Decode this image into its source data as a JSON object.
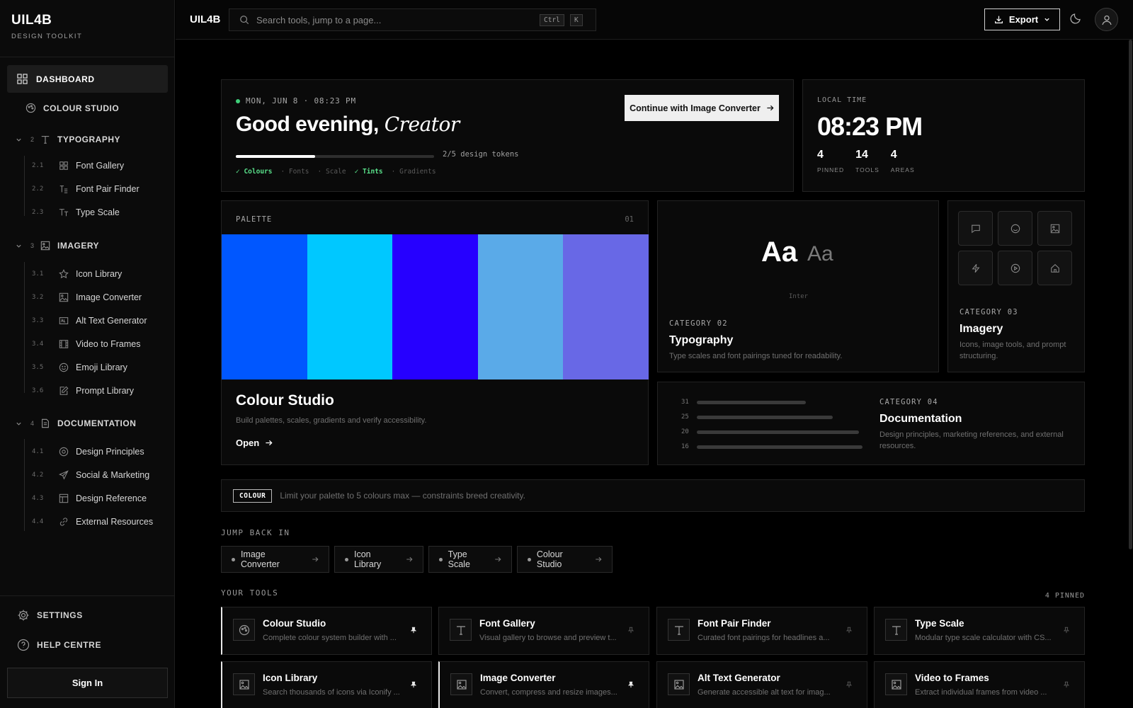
{
  "brand": {
    "title": "UIL4B",
    "subtitle": "DESIGN TOOLKIT"
  },
  "sidebar": {
    "dashboard": "DASHBOARD",
    "colour_studio": "COLOUR STUDIO",
    "sections": [
      {
        "num": "2",
        "label": "TYPOGRAPHY",
        "items": [
          {
            "num": "2.1",
            "label": "Font Gallery"
          },
          {
            "num": "2.2",
            "label": "Font Pair Finder"
          },
          {
            "num": "2.3",
            "label": "Type Scale"
          }
        ]
      },
      {
        "num": "3",
        "label": "IMAGERY",
        "items": [
          {
            "num": "3.1",
            "label": "Icon Library"
          },
          {
            "num": "3.2",
            "label": "Image Converter"
          },
          {
            "num": "3.3",
            "label": "Alt Text Generator"
          },
          {
            "num": "3.4",
            "label": "Video to Frames"
          },
          {
            "num": "3.5",
            "label": "Emoji Library"
          },
          {
            "num": "3.6",
            "label": "Prompt Library"
          }
        ]
      },
      {
        "num": "4",
        "label": "DOCUMENTATION",
        "items": [
          {
            "num": "4.1",
            "label": "Design Principles"
          },
          {
            "num": "4.2",
            "label": "Social & Marketing"
          },
          {
            "num": "4.3",
            "label": "Design Reference"
          },
          {
            "num": "4.4",
            "label": "External Resources"
          }
        ]
      }
    ],
    "settings": "SETTINGS",
    "help": "HELP CENTRE",
    "sign_in": "Sign In"
  },
  "topbar": {
    "brand": "UIL4B",
    "search_placeholder": "Search tools, jump to a page...",
    "kbd1": "Ctrl",
    "kbd2": "K",
    "export": "Export"
  },
  "greeting": {
    "date": "MON, JUN 8 · 08:23 PM",
    "hello": "Good evening,",
    "name": "Creator",
    "progress": 0.4,
    "progress_label": "2/5 design tokens",
    "tokens": [
      {
        "label": "✓ Colours",
        "done": true
      },
      {
        "label": "· Fonts",
        "done": false
      },
      {
        "label": "· Scale",
        "done": false
      },
      {
        "label": "✓ Tints",
        "done": true
      },
      {
        "label": "· Gradients",
        "done": false
      }
    ],
    "continue_label": "Continue with Image Converter"
  },
  "clock": {
    "label": "LOCAL TIME",
    "time": "08:23 PM",
    "stats": [
      {
        "value": "4",
        "label": "PINNED"
      },
      {
        "value": "14",
        "label": "TOOLS"
      },
      {
        "value": "4",
        "label": "AREAS"
      }
    ]
  },
  "palette": {
    "header": "PALETTE",
    "num": "01",
    "swatches": [
      "#0057ff",
      "#00c8ff",
      "#2600ff",
      "#5aaae8",
      "#6868e6"
    ],
    "title": "Colour Studio",
    "desc": "Build palettes, scales, gradients and verify accessibility.",
    "open": "Open"
  },
  "typography_card": {
    "big": "Aa",
    "small": "Aa",
    "font": "Inter",
    "category": "CATEGORY 02",
    "title": "Typography",
    "desc": "Type scales and font pairings tuned for readability."
  },
  "imagery_card": {
    "category": "CATEGORY 03",
    "title": "Imagery",
    "desc": "Icons, image tools, and prompt structuring."
  },
  "documentation_card": {
    "rows": [
      "31",
      "25",
      "20",
      "16"
    ],
    "category": "CATEGORY 04",
    "title": "Documentation",
    "desc": "Design principles, marketing references, and external resources."
  },
  "tip": {
    "badge": "COLOUR",
    "text": "Limit your palette to 5 colours max — constraints breed creativity."
  },
  "jump_back": {
    "label": "JUMP BACK IN",
    "chips": [
      "Image Converter",
      "Icon Library",
      "Type Scale",
      "Colour Studio"
    ]
  },
  "your_tools": {
    "label": "YOUR TOOLS",
    "pinned_count": "4 PINNED",
    "tools": [
      {
        "name": "Colour Studio",
        "desc": "Complete colour system builder with ...",
        "icon": "palette-icon",
        "pinned": true
      },
      {
        "name": "Font Gallery",
        "desc": "Visual gallery to browse and preview t...",
        "icon": "type-icon",
        "pinned": false
      },
      {
        "name": "Font Pair Finder",
        "desc": "Curated font pairings for headlines a...",
        "icon": "type-icon",
        "pinned": false
      },
      {
        "name": "Type Scale",
        "desc": "Modular type scale calculator with CS...",
        "icon": "type-icon",
        "pinned": false
      },
      {
        "name": "Icon Library",
        "desc": "Search thousands of icons via Iconify ...",
        "icon": "image-icon",
        "pinned": true
      },
      {
        "name": "Image Converter",
        "desc": "Convert, compress and resize images...",
        "icon": "image-icon",
        "pinned": true
      },
      {
        "name": "Alt Text Generator",
        "desc": "Generate accessible alt text for imag...",
        "icon": "image-icon",
        "pinned": false
      },
      {
        "name": "Video to Frames",
        "desc": "Extract individual frames from video ...",
        "icon": "image-icon",
        "pinned": false
      }
    ]
  }
}
